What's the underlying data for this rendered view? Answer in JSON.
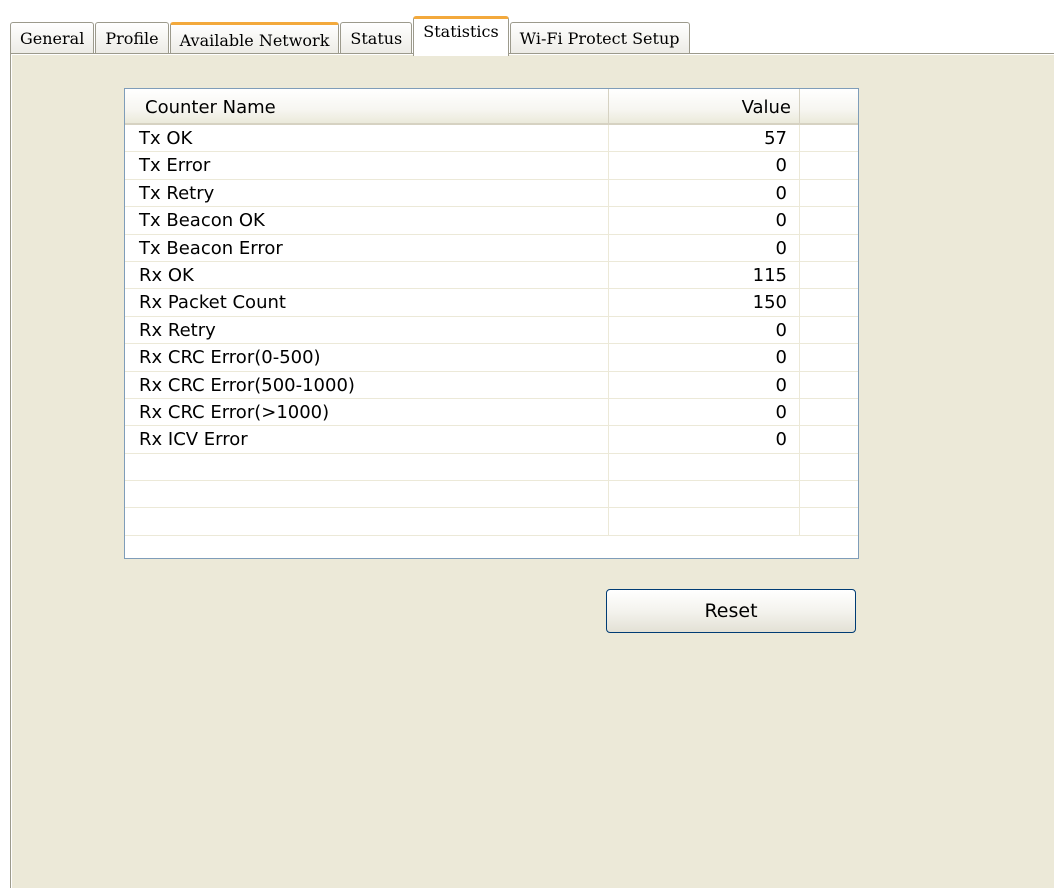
{
  "tabs": [
    {
      "label": "General"
    },
    {
      "label": "Profile"
    },
    {
      "label": "Available Network"
    },
    {
      "label": "Status"
    },
    {
      "label": "Statistics"
    },
    {
      "label": "Wi-Fi Protect Setup"
    }
  ],
  "active_tab": "Statistics",
  "table": {
    "columns": [
      "Counter Name",
      "Value"
    ],
    "rows": [
      {
        "name": "Tx OK",
        "value": "57"
      },
      {
        "name": "Tx Error",
        "value": "0"
      },
      {
        "name": "Tx Retry",
        "value": "0"
      },
      {
        "name": "Tx Beacon OK",
        "value": "0"
      },
      {
        "name": "Tx Beacon Error",
        "value": "0"
      },
      {
        "name": "Rx OK",
        "value": "115"
      },
      {
        "name": "Rx Packet Count",
        "value": "150"
      },
      {
        "name": "Rx Retry",
        "value": "0"
      },
      {
        "name": "Rx CRC Error(0-500)",
        "value": "0"
      },
      {
        "name": "Rx CRC Error(500-1000)",
        "value": "0"
      },
      {
        "name": "Rx CRC Error(>1000)",
        "value": "0"
      },
      {
        "name": "Rx ICV Error",
        "value": "0"
      },
      {
        "name": "",
        "value": ""
      },
      {
        "name": "",
        "value": ""
      },
      {
        "name": "",
        "value": ""
      }
    ]
  },
  "buttons": {
    "reset_label": "Reset"
  },
  "colors": {
    "panel_background": "#ece9d8",
    "tab_highlight": "#f3a93c",
    "list_border": "#7f9db9",
    "button_border": "#003c74"
  }
}
